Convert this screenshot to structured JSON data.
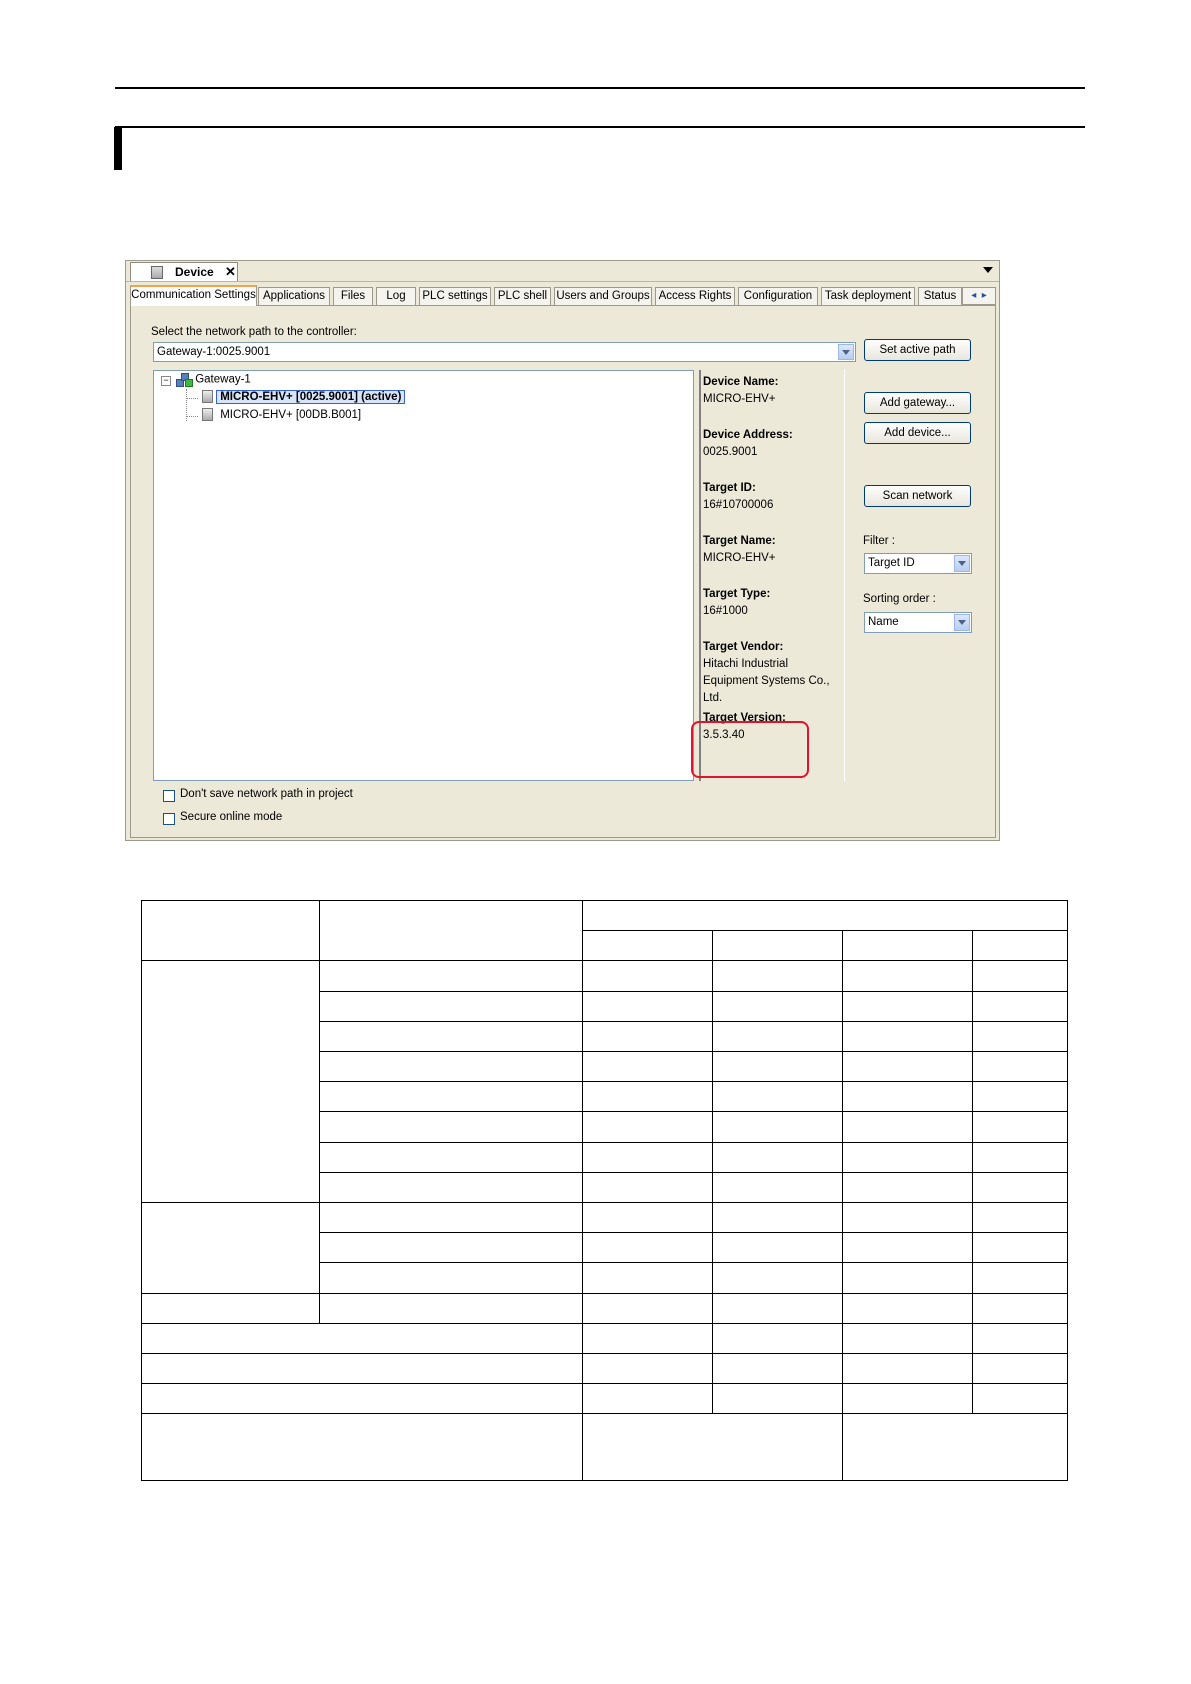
{
  "window": {
    "doc_tab": "Device",
    "tabs": [
      "Communication Settings",
      "Applications",
      "Files",
      "Log",
      "PLC settings",
      "PLC shell",
      "Users and Groups",
      "Access Rights",
      "Configuration",
      "Task deployment",
      "Status"
    ],
    "select_label": "Select the network path to the controller:",
    "path_value": "Gateway-1:0025.9001",
    "tree": {
      "gateway": "Gateway-1",
      "device_active": "MICRO-EHV+ [0025.9001] (active)",
      "device_other": "MICRO-EHV+ [00DB.B001]"
    },
    "info": {
      "device_name_label": "Device Name:",
      "device_name": "MICRO-EHV+",
      "device_address_label": "Device Address:",
      "device_address": "0025.9001",
      "target_id_label": "Target ID:",
      "target_id": "16#10700006",
      "target_name_label": "Target Name:",
      "target_name": "MICRO-EHV+",
      "target_type_label": "Target Type:",
      "target_type": "16#1000",
      "target_vendor_label": "Target Vendor:",
      "target_vendor": "Hitachi Industrial Equipment Systems Co., Ltd.",
      "target_version_label": "Target Version:",
      "target_version": "3.5.3.40"
    },
    "buttons": {
      "set_active_path": "Set active path",
      "add_gateway": "Add gateway...",
      "add_device": "Add device...",
      "scan_network": "Scan network"
    },
    "filter_label": "Filter :",
    "filter_value": "Target ID",
    "sorting_label": "Sorting order :",
    "sorting_value": "Name",
    "checkboxes": {
      "dont_save": "Don't save network path in project",
      "secure_online": "Secure online mode"
    },
    "colors": {
      "highlight_box": "#e0142c",
      "active_tab_accent": "#f2a44a"
    }
  }
}
